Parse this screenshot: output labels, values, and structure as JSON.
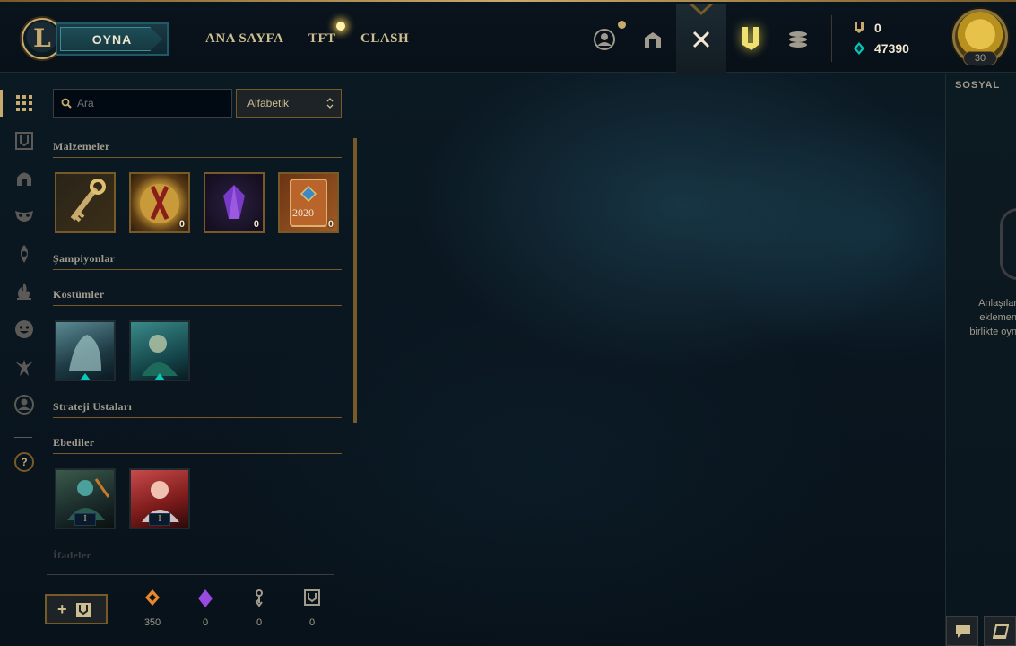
{
  "header": {
    "logo_letter": "L",
    "play_label": "OYNA",
    "nav": [
      "ANA SAYFA",
      "TFT",
      "CLASH"
    ],
    "currencies": [
      {
        "icon": "rp-icon",
        "value": "0"
      },
      {
        "icon": "blue-essence-icon",
        "value": "47390"
      }
    ],
    "level": "30",
    "top_icons": [
      "profile-icon",
      "collection-icon",
      "loot-icon",
      "store-icon",
      "tokens-icon",
      "coins-icon"
    ]
  },
  "rail": {
    "items": [
      "grid-icon",
      "chest-icon",
      "helmet-icon",
      "mask-icon",
      "ward-icon",
      "flame-icon",
      "emote-icon",
      "champion-icon",
      "avatar-icon"
    ],
    "help": "?"
  },
  "panel": {
    "search_placeholder": "Ara",
    "sort_label": "Alfabetik",
    "categories": {
      "materials": "Malzemeler",
      "champions": "Şampiyonlar",
      "skins": "Kostümler",
      "tacticians": "Strateji Ustaları",
      "eternals": "Ebediler",
      "emotes": "İfadeler"
    },
    "materials": [
      {
        "name": "hextech-key",
        "count": ""
      },
      {
        "name": "orb",
        "count": "0"
      },
      {
        "name": "gemstone",
        "count": "0"
      },
      {
        "name": "chest-2020",
        "count": "0",
        "label": "2020"
      }
    ],
    "skins": [
      {
        "name": "skin-1"
      },
      {
        "name": "skin-2"
      }
    ],
    "eternals": [
      {
        "name": "eternal-1",
        "rank": "I"
      },
      {
        "name": "eternal-2",
        "rank": "I"
      }
    ],
    "add_plus": "+",
    "stats": [
      {
        "icon": "orange-essence-icon",
        "value": "350"
      },
      {
        "icon": "gem-icon",
        "value": "0"
      },
      {
        "icon": "key-fragment-icon",
        "value": "0"
      },
      {
        "icon": "chest-icon",
        "value": "0"
      }
    ]
  },
  "social": {
    "title": "SOSYAL",
    "text": [
      "Anlaşılar",
      "eklemen",
      "birlikte oyn"
    ]
  },
  "colors": {
    "gold": "#c8aa6e",
    "dark_gold": "#785a28",
    "teal": "#0ac8b9",
    "bg": "#091018"
  }
}
